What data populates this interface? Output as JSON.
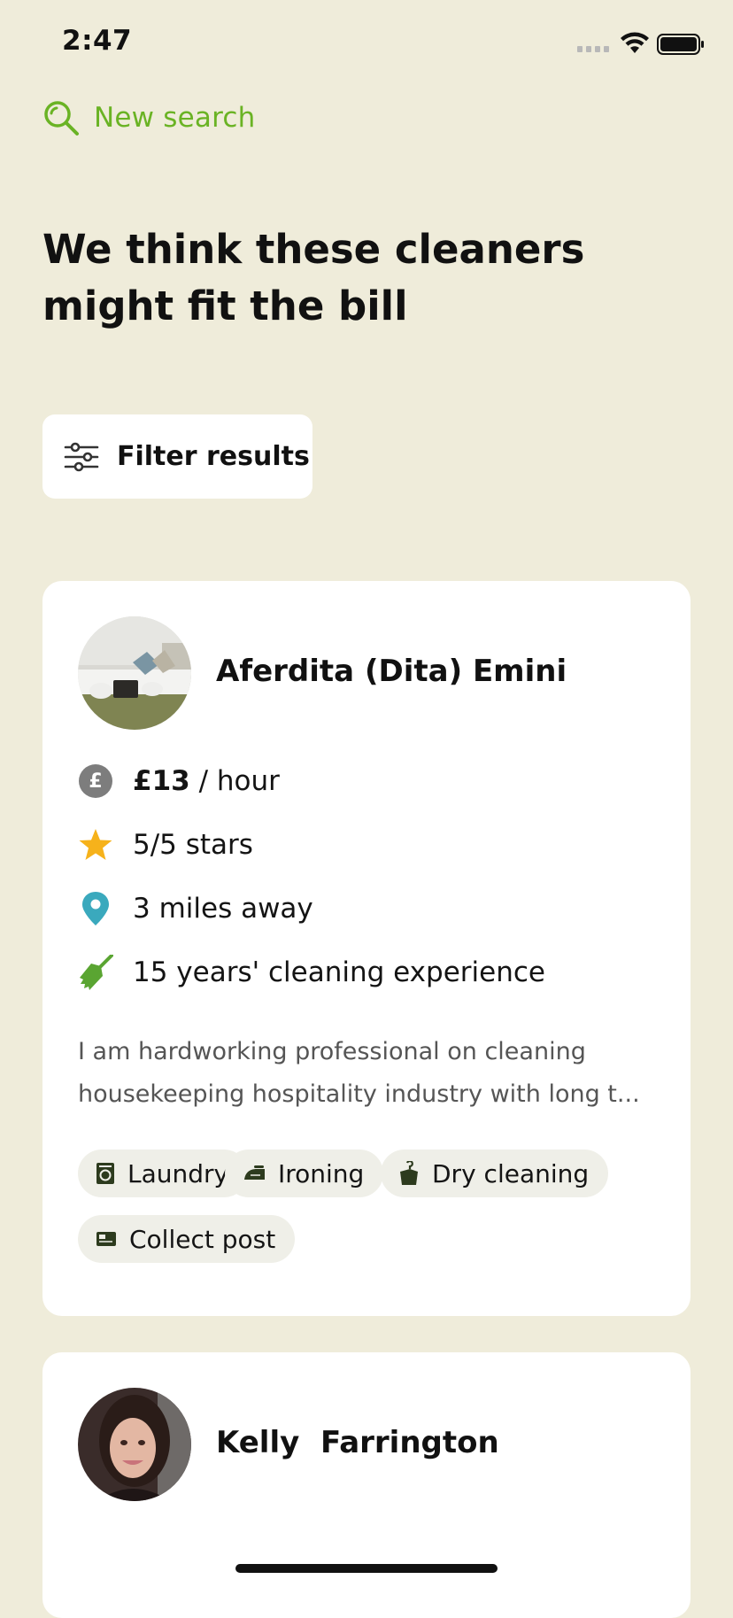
{
  "status_bar": {
    "time": "2:47"
  },
  "nav": {
    "new_search_label": "New search"
  },
  "headline": "We think these cleaners might fit the bill",
  "filter": {
    "label": "Filter results"
  },
  "cleaners": [
    {
      "name": "Aferdita (Dita) Emini",
      "rate_amount": "£13",
      "rate_unit": " / hour",
      "rating": "5/5 stars",
      "distance": "3 miles away",
      "experience": "15 years' cleaning experience",
      "description": "I am hardworking professional on cleaning housekeeping hospitality industry with long t...",
      "services": [
        "Laundry",
        "Ironing",
        "Dry cleaning",
        "Collect post"
      ]
    },
    {
      "name": "Kelly  Farrington"
    }
  ],
  "colors": {
    "background": "#efecda",
    "accent_green": "#6ab324",
    "star": "#f6b21b",
    "pin": "#3aa9bd",
    "broom": "#5aa532",
    "pound_badge": "#7d7d7d"
  }
}
